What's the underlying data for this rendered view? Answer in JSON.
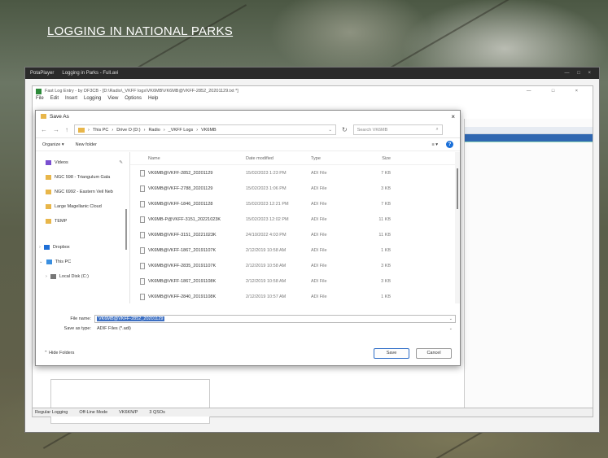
{
  "slide_title": "LOGGING IN NATIONAL PARKS",
  "app": {
    "title_left": "PotaPlayer",
    "title_mid": "Logging in Parks - Full.avi",
    "window_controls": "— □ ×"
  },
  "inner": {
    "title": "Fast Log Entry - by DF3CB - [D:\\Radio\\_VKFF logs\\VK6MB\\VK6MB@VKFF-2852_20201129.txt *]",
    "window_controls": "— □ ×",
    "menu": [
      "File",
      "Edit",
      "Insert",
      "Logging",
      "View",
      "Options",
      "Help"
    ]
  },
  "status": {
    "items": [
      "Regular Logging",
      "Off-Line Mode",
      "VK6KN/P",
      "3 QSOs"
    ]
  },
  "dialog": {
    "title": "Save As",
    "close": "×",
    "path": [
      "This PC",
      "Drive O (D:)",
      "Radio",
      "_VKFF Logs",
      "VK6MB"
    ],
    "search_placeholder": "Search VK6MB",
    "organize": "Organize ▾",
    "new_folder": "New folder",
    "help": "?",
    "nav_items": [
      {
        "label": "Videos",
        "color": "#7a4fd0"
      },
      {
        "label": "NGC 598 - Triangulum Gala",
        "color": "#e8b64a"
      },
      {
        "label": "NGC 6992 - Eastern Veil Neb",
        "color": "#e8b64a"
      },
      {
        "label": "Large Magellanic Cloud",
        "color": "#e8b64a"
      },
      {
        "label": "TEMP",
        "color": "#e8b64a"
      },
      {
        "label": "Dropbox",
        "color": "#1f6fd6"
      },
      {
        "label": "This PC",
        "color": "#3a8fe0"
      },
      {
        "label": "Local Disk (C:)",
        "color": "#777"
      }
    ],
    "columns": {
      "name": "Name",
      "date": "Date modified",
      "type": "Type",
      "size": "Size"
    },
    "files": [
      {
        "name": "VK6MB@VKFF-2852_20201129",
        "date": "15/02/2023 1:23 PM",
        "type": "ADI File",
        "size": "7 KB"
      },
      {
        "name": "VK6MB@VKFF-2788_20201129",
        "date": "15/02/2023 1:06 PM",
        "type": "ADI File",
        "size": "3 KB"
      },
      {
        "name": "VK6MB@VKFF-1846_20201128",
        "date": "15/02/2023 12:21 PM",
        "type": "ADI File",
        "size": "7 KB"
      },
      {
        "name": "VK6MB-P@VKFF-3151_20221023K",
        "date": "15/02/2023 12:02 PM",
        "type": "ADI File",
        "size": "11 KB"
      },
      {
        "name": "VK6MB@VKFF-3151_20221023K",
        "date": "24/10/2022 4:03 PM",
        "type": "ADI File",
        "size": "11 KB"
      },
      {
        "name": "VK6MB@VKFF-1867_20191107K",
        "date": "2/12/2019 10:58 AM",
        "type": "ADI File",
        "size": "1 KB"
      },
      {
        "name": "VK6MB@VKFF-2835_20191107K",
        "date": "2/12/2019 10:58 AM",
        "type": "ADI File",
        "size": "3 KB"
      },
      {
        "name": "VK6MB@VKFF-1867_20191108K",
        "date": "2/12/2019 10:58 AM",
        "type": "ADI File",
        "size": "3 KB"
      },
      {
        "name": "VK6MB@VKFF-2840_20191108K",
        "date": "2/12/2019 10:57 AM",
        "type": "ADI File",
        "size": "1 KB"
      }
    ],
    "file_name_label": "File name:",
    "file_name_value": "VK6MB@VKFF-2852_20201129",
    "save_type_label": "Save as type:",
    "save_type_value": "ADIF Files (*.adi)",
    "hide_folders": "Hide Folders",
    "save": "Save",
    "cancel": "Cancel"
  }
}
